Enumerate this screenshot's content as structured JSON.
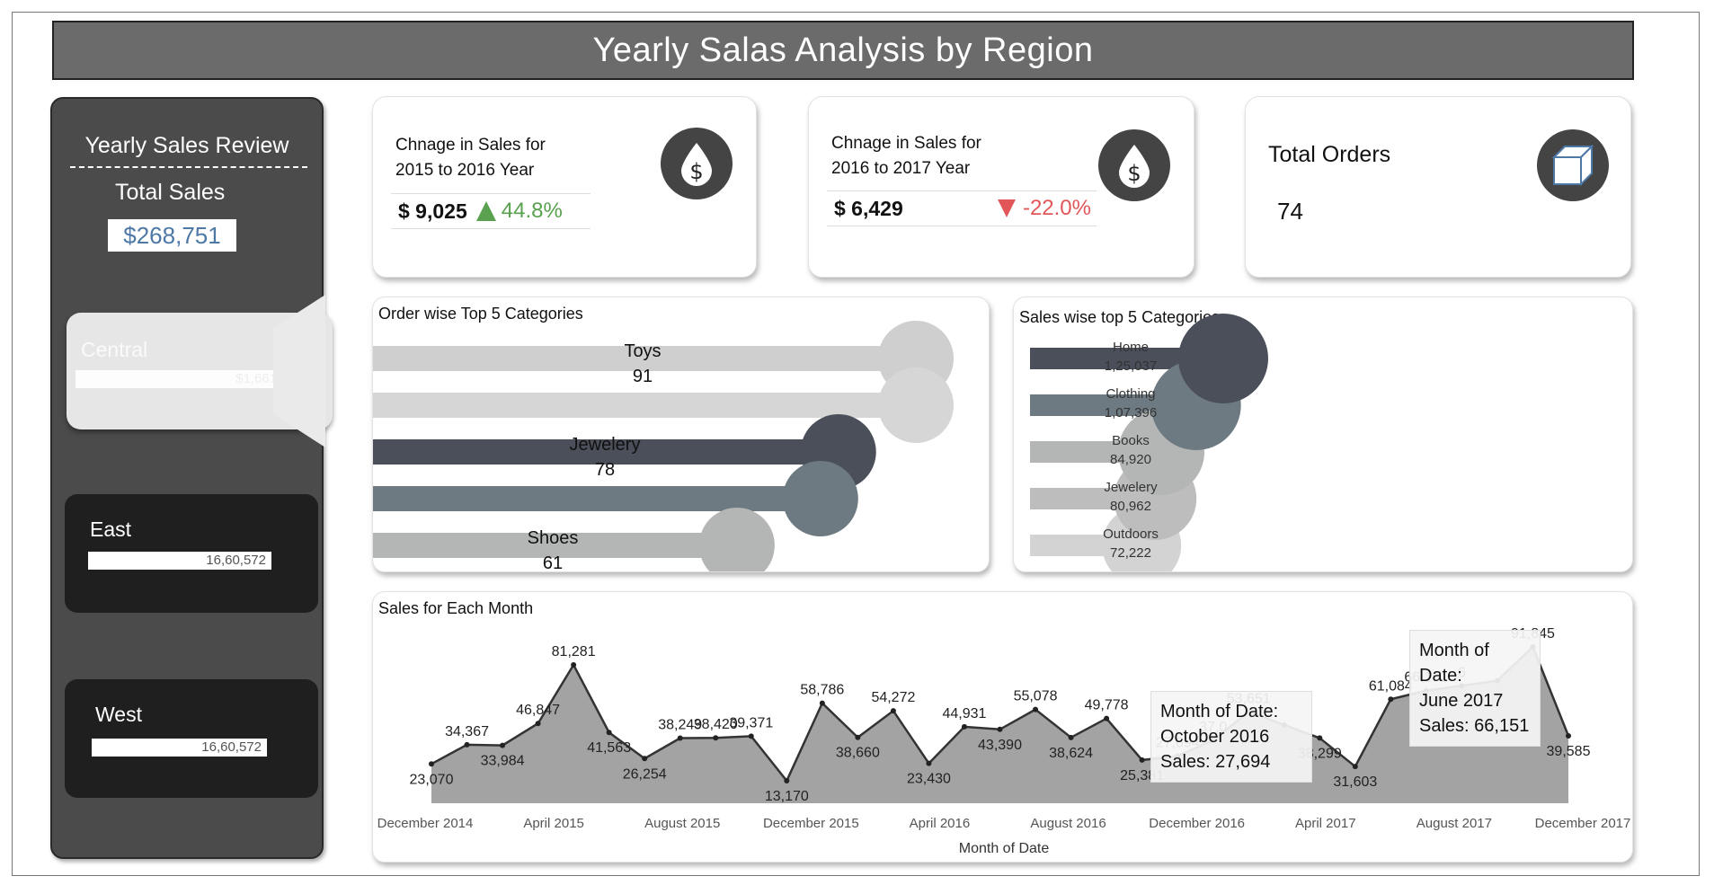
{
  "title": "Yearly Salas Analysis by Region",
  "sidebar": {
    "heading": "Yearly Sales Review",
    "total_label": "Total Sales",
    "total_value": "$268,751",
    "regions": [
      {
        "name": "Central",
        "value": "$1,661K"
      },
      {
        "name": "East",
        "value": "16,60,572"
      },
      {
        "name": "West",
        "value": "16,60,572"
      }
    ]
  },
  "kpis": {
    "change_2015_2016": {
      "title": "Chnage in Sales for 2015 to 2016 Year",
      "value": "$ 9,025",
      "pct": "44.8%",
      "direction": "up"
    },
    "change_2016_2017": {
      "title": "Chnage in Sales for 2016 to 2017 Year",
      "value": "$ 6,429",
      "pct": "-22.0%",
      "direction": "down"
    },
    "total_orders": {
      "title": "Total Orders",
      "value": "74"
    }
  },
  "icons": {
    "kpi1": "dollar-drop-icon",
    "kpi2": "dollar-drop-icon",
    "kpi3": "box-icon"
  },
  "colors": {
    "dark": "#4a4f5a",
    "slate": "#6e7a82",
    "grey": "#b4b6b6",
    "light": "#cfcfcf",
    "up": "#59a14f",
    "down": "#e15759",
    "blue": "#4e79a7"
  },
  "chart_data": [
    {
      "type": "bar",
      "title": "Order wise Top 5 Categories",
      "categories": [
        "Toys",
        "",
        "Jewelery",
        "",
        "Shoes"
      ],
      "values": [
        91,
        91,
        78,
        75,
        61
      ],
      "labels": [
        "91",
        "",
        "78",
        "",
        "61"
      ]
    },
    {
      "type": "bar",
      "title": "Sales wise top 5 Categories",
      "categories": [
        "Home",
        "Clothing",
        "Books",
        "Jewelery",
        "Outdoors"
      ],
      "values": [
        125037,
        107396,
        84920,
        80962,
        72222
      ],
      "labels": [
        "1,25,037",
        "1,07,396",
        "84,920",
        "80,962",
        "72,222"
      ]
    },
    {
      "type": "area",
      "title": "Sales for Each Month",
      "xlabel": "Month of Date",
      "x_ticks": [
        "December 2014",
        "April 2015",
        "August 2015",
        "December 2015",
        "April 2016",
        "August 2016",
        "December 2016",
        "April 2017",
        "August 2017",
        "December 2017"
      ],
      "values": [
        23070,
        34367,
        33984,
        46847,
        81281,
        41563,
        26254,
        38249,
        38420,
        39371,
        13170,
        58786,
        38660,
        54272,
        23430,
        44931,
        43390,
        55078,
        38624,
        49778,
        25381,
        27694,
        37000,
        53651,
        46000,
        38299,
        21603,
        61084,
        66151,
        69000,
        72000,
        91845,
        39585
      ],
      "point_labels": [
        "23,070",
        "34,367",
        "33,984",
        "46,847",
        "81,281",
        "41,563",
        "26,254",
        "38,249",
        "38,420",
        "39,371",
        "13,170",
        "58,786",
        "38,660",
        "54,272",
        "23,430",
        "44,931",
        "43,390",
        "55,078",
        "38,624",
        "49,778",
        "25,381",
        "27,694",
        "37,0",
        "53,651",
        "",
        "38,299",
        "31,603",
        "61,084",
        "66,151",
        "6",
        "",
        "91,845",
        "39,585"
      ],
      "tooltips": [
        {
          "lines": [
            "Month of Date:",
            "October 2016",
            "Sales: 27,694"
          ]
        },
        {
          "lines": [
            "Month of Date:",
            "June 2017",
            "Sales: 66,151"
          ]
        }
      ]
    }
  ]
}
